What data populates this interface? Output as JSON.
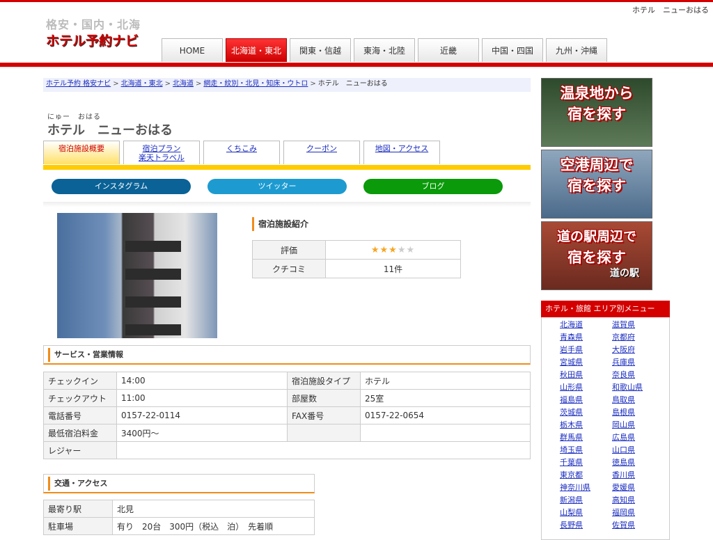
{
  "header": {
    "top_right": "ホテル　ニューおはる",
    "logo_line1": "格安・国内・北海",
    "logo_line2": "ホテル予約ナビ",
    "nav": [
      "HOME",
      "北海道・東北",
      "関東・信越",
      "東海・北陸",
      "近畿",
      "中国・四国",
      "九州・沖縄"
    ],
    "nav_active_index": 1
  },
  "breadcrumb": {
    "items": [
      "ホテル予約 格安ナビ",
      "北海道・東北",
      "北海道",
      "網走・紋別・北見・知床・ウトロ"
    ],
    "current": "ホテル　ニューおはる",
    "sep": ">"
  },
  "hotel": {
    "ruby": "にゅー　おはる",
    "name": "ホテル　ニューおはる"
  },
  "subtabs": [
    {
      "line1": "宿泊施設概要",
      "line2": ""
    },
    {
      "line1": "宿泊プラン",
      "line2": "楽天トラベル"
    },
    {
      "line1": "くちこみ",
      "line2": ""
    },
    {
      "line1": "クーポン",
      "line2": ""
    },
    {
      "line1": "地図・アクセス",
      "line2": ""
    }
  ],
  "sns": [
    {
      "label": "インスタグラム",
      "color": "#0a6296"
    },
    {
      "label": "ツイッター",
      "color": "#1d9bd1"
    },
    {
      "label": "ブログ",
      "color": "#0a9a0a"
    }
  ],
  "intro": {
    "title": "宿泊施設紹介",
    "rating_label": "評価",
    "rating_value": 3,
    "rating_max": 5,
    "review_label": "クチコミ",
    "review_count": "11件"
  },
  "service": {
    "title": "サービス・営業情報",
    "rows": [
      [
        "チェックイン",
        "14:00",
        "宿泊施設タイプ",
        "ホテル"
      ],
      [
        "チェックアウト",
        "11:00",
        "部屋数",
        "25室"
      ],
      [
        "電話番号",
        "0157-22-0114",
        "FAX番号",
        "0157-22-0654"
      ],
      [
        "最低宿泊料金",
        "3400円～",
        "",
        ""
      ],
      [
        "レジャー",
        "",
        "",
        ""
      ]
    ]
  },
  "access": {
    "title": "交通・アクセス",
    "rows": [
      [
        "最寄り駅",
        "北見"
      ],
      [
        "駐車場",
        "有り　20台　300円（税込　泊）　先着順"
      ]
    ]
  },
  "banners": [
    {
      "line1": "温泉地から",
      "line2": "宿を探す",
      "bg": "#3d5a3a"
    },
    {
      "line1": "空港周辺で",
      "line2": "宿を探す",
      "bg": "#6c8aa8"
    },
    {
      "line1": "道の駅周辺で",
      "line2": "宿を探す",
      "bg": "#8c3a2a",
      "extra": "道の駅"
    }
  ],
  "area_menu": {
    "title": "ホテル・旅館 エリア別メニュー",
    "col1": [
      "北海道",
      "青森県",
      "岩手県",
      "宮城県",
      "秋田県",
      "山形県",
      "福島県",
      "茨城県",
      "栃木県",
      "群馬県",
      "埼玉県",
      "千葉県",
      "東京都",
      "神奈川県",
      "新潟県",
      "山梨県",
      "長野県"
    ],
    "col2": [
      "滋賀県",
      "京都府",
      "大阪府",
      "兵庫県",
      "奈良県",
      "和歌山県",
      "鳥取県",
      "島根県",
      "岡山県",
      "広島県",
      "山口県",
      "徳島県",
      "香川県",
      "愛媛県",
      "高知県",
      "福岡県",
      "佐賀県"
    ]
  }
}
